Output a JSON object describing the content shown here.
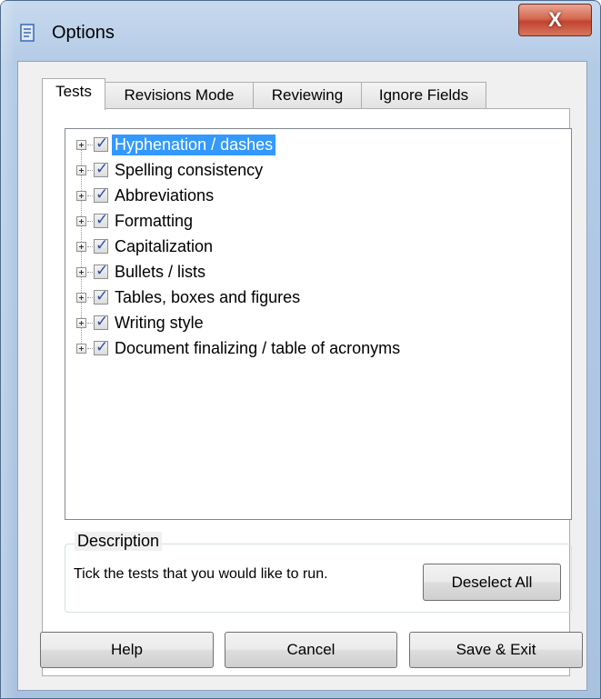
{
  "window": {
    "title": "Options",
    "close_label": "X"
  },
  "tabs": [
    {
      "label": "Tests",
      "active": true
    },
    {
      "label": "Revisions Mode",
      "active": false
    },
    {
      "label": "Reviewing",
      "active": false
    },
    {
      "label": "Ignore Fields",
      "active": false
    }
  ],
  "tests": [
    {
      "label": "Hyphenation / dashes",
      "checked": true,
      "selected": true
    },
    {
      "label": "Spelling consistency",
      "checked": true,
      "selected": false
    },
    {
      "label": "Abbreviations",
      "checked": true,
      "selected": false
    },
    {
      "label": "Formatting",
      "checked": true,
      "selected": false
    },
    {
      "label": "Capitalization",
      "checked": true,
      "selected": false
    },
    {
      "label": "Bullets / lists",
      "checked": true,
      "selected": false
    },
    {
      "label": "Tables, boxes and figures",
      "checked": true,
      "selected": false
    },
    {
      "label": "Writing style",
      "checked": true,
      "selected": false
    },
    {
      "label": "Document finalizing / table of acronyms",
      "checked": true,
      "selected": false
    }
  ],
  "description": {
    "title": "Description",
    "text": "Tick the tests that you would like  to run."
  },
  "buttons": {
    "deselect_all": "Deselect All",
    "help": "Help",
    "cancel": "Cancel",
    "save_exit": "Save & Exit"
  },
  "colors": {
    "selection": "#3399ff",
    "check": "#2b4fa6",
    "close_button": "#c24431"
  },
  "icons": {
    "app": "document-options-icon",
    "close": "close-icon",
    "expander": "plus-expander-icon",
    "check": "checkmark-icon"
  }
}
